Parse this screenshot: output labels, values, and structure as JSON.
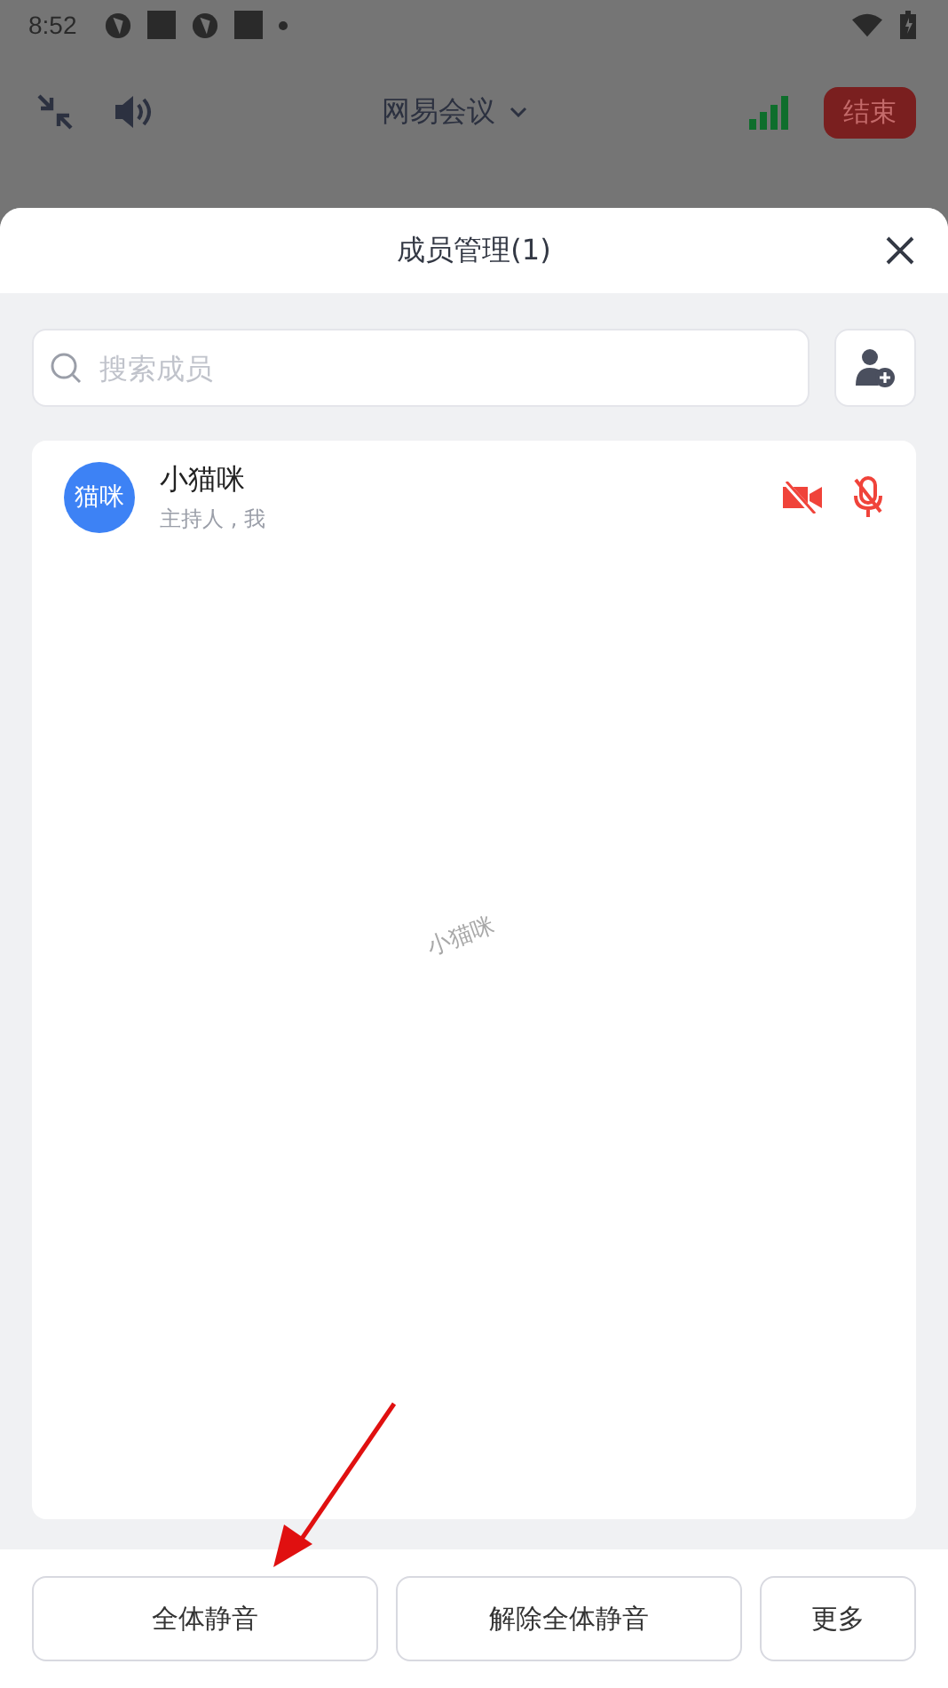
{
  "status_bar": {
    "time": "8:52"
  },
  "toolbar": {
    "title": "网易会议",
    "end_button": "结束"
  },
  "sheet": {
    "title": "成员管理(1)",
    "search": {
      "placeholder": "搜索成员"
    },
    "members": [
      {
        "avatar": "猫咪",
        "name": "小猫咪",
        "role": "主持人 , 我",
        "video_muted": true,
        "mic_muted": true
      }
    ],
    "watermark": "小猫咪",
    "buttons": [
      "全体静音",
      "解除全体静音",
      "更多"
    ]
  }
}
